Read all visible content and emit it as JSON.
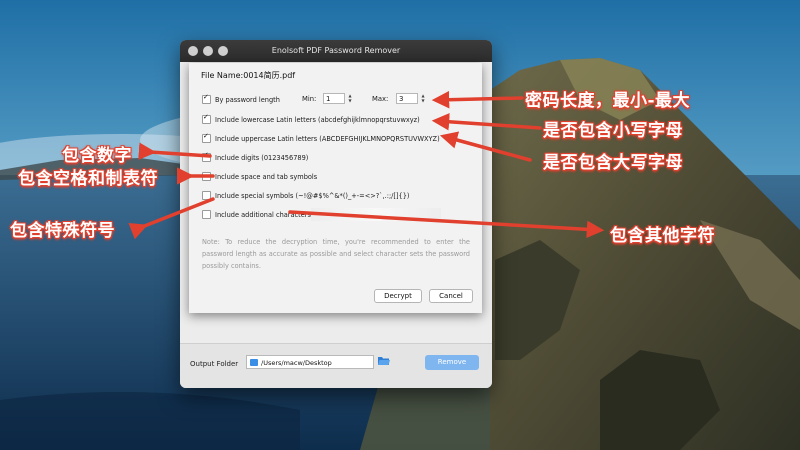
{
  "window": {
    "title": "Enolsoft PDF Password Remover",
    "output_label": "Output Folder",
    "output_path": "/Users/macw/Desktop",
    "remove_label": "Remove"
  },
  "dialog": {
    "file_name_label": "File Name:",
    "file_name": "0014简历.pdf",
    "by_length_label": "By password length",
    "min_label": "Min:",
    "min_value": "1",
    "max_label": "Max:",
    "max_value": "3",
    "options": [
      {
        "label": "Include lowercase Latin letters (abcdefghijklmnopqrstuvwxyz)",
        "checked": true
      },
      {
        "label": "Include uppercase Latin letters (ABCDEFGHIJKLMNOPQRSTUVWXYZ)",
        "checked": true
      },
      {
        "label": "Include digits (0123456789)",
        "checked": true
      },
      {
        "label": "Include space and tab symbols",
        "checked": false
      },
      {
        "label": "Include special symbols (~!@#$%^&*()_+-=<>?`,.:;/[]{})",
        "checked": false
      },
      {
        "label": "Include additional characters",
        "checked": false
      }
    ],
    "note": "Note: To reduce the decryption time, you're recommended to enter the password length as accurate as possible and select character sets the password possibly contains.",
    "decrypt_label": "Decrypt",
    "cancel_label": "Cancel"
  },
  "annotations": {
    "length": "密码长度，最小-最大",
    "lowercase": "是否包含小写字母",
    "uppercase": "是否包含大写字母",
    "digits": "包含数字",
    "space_tab": "包含空格和制表符",
    "special": "包含特殊符号",
    "other": "包含其他字符",
    "color": "#e0402d"
  }
}
